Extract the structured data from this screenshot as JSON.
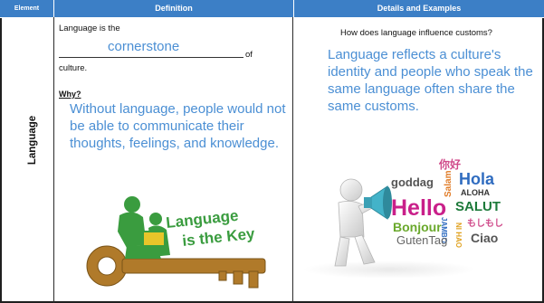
{
  "table": {
    "headers": {
      "element": "Element",
      "definition": "Definition",
      "details": "Details and Examples"
    },
    "element_label": "Language"
  },
  "definition": {
    "prompt_start": "Language is the",
    "answer_blank": "cornerstone",
    "prompt_of": "of",
    "prompt_end": "culture.",
    "why_label": "Why?",
    "why_answer": "Without language, people would not be able to communicate their thoughts, feelings, and knowledge."
  },
  "details": {
    "question": "How does language influence customs?",
    "answer": "Language reflects a culture's identity and people who speak the same language often share the same customs."
  },
  "images": {
    "key_logo": {
      "line1": "Language",
      "line2": "is the Key",
      "green": "#3a9c3f",
      "brown": "#b07a2a",
      "yellow": "#e8c52a"
    },
    "speaker_words": [
      "你好",
      "goddag",
      "Salam",
      "Hola",
      "ALOHA",
      "Hello",
      "SALUT",
      "Bonjour",
      "JAMBO",
      "NI HAO",
      "もしもし",
      "GutenTag",
      "Ciao"
    ]
  },
  "colors": {
    "header_bg": "#3c7fc6",
    "answer_text": "#4b8fd4"
  }
}
